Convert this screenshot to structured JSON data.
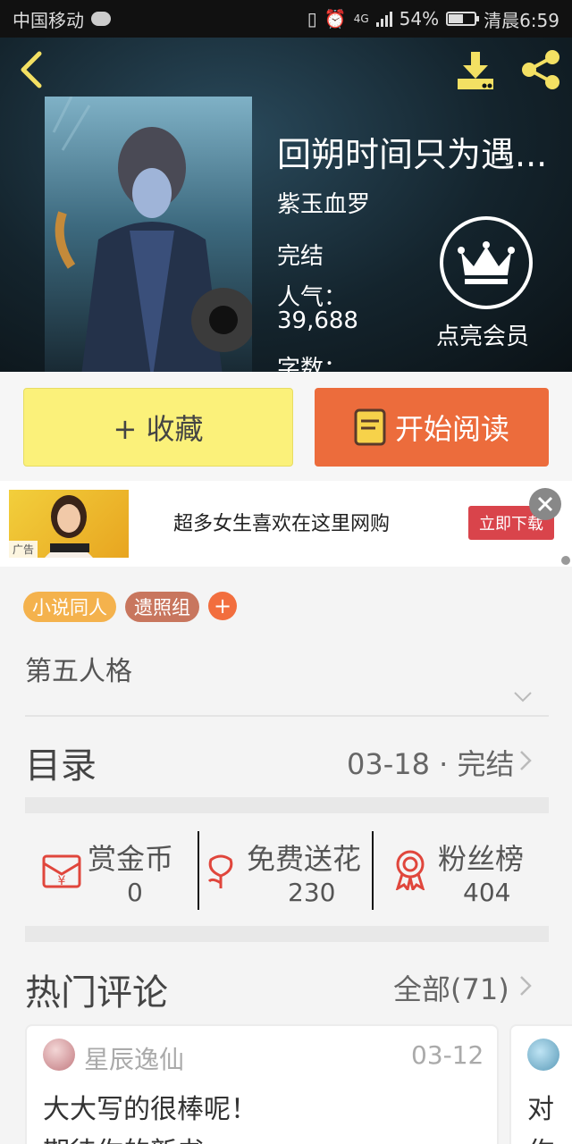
{
  "status_bar": {
    "carrier": "中国移动",
    "network": "4G",
    "battery": "54%",
    "time": "清晨6:59"
  },
  "book": {
    "title": "回朔时间只为遇...",
    "author": "紫玉血罗",
    "status": "完结",
    "popularity_label": "人气：",
    "popularity_value": "39,688",
    "word_count_label": "字数："
  },
  "vip": {
    "label": "点亮会员"
  },
  "actions": {
    "favorite_label": "+ 收藏",
    "read_label": "开始阅读"
  },
  "ad": {
    "text": "超多女生喜欢在这里网购",
    "button": "立即下载",
    "tag": "广告"
  },
  "tags": [
    "小说同人",
    "遗照组"
  ],
  "tag_add": "+",
  "synopsis": "第五人格",
  "toc": {
    "title": "目录",
    "info": "03-18 · 完结"
  },
  "stats": [
    {
      "label": "赏金币",
      "value": "0"
    },
    {
      "label": "免费送花",
      "value": "230"
    },
    {
      "label": "粉丝榜",
      "value": "404"
    }
  ],
  "comments": {
    "title": "热门评论",
    "all_label": "全部(71)",
    "items": [
      {
        "user": "星辰逸仙",
        "date": "03-12",
        "line1": "大大写的很棒呢！",
        "line2": "期待你的新书"
      },
      {
        "line1": "对",
        "line2": "作"
      }
    ]
  },
  "colors": {
    "favorite_bg": "#fbf17a",
    "read_bg": "#ec6c3c",
    "tag_1": "#f4b24d",
    "tag_2": "#c8765e",
    "tag_add": "#f26e3e",
    "icon_red": "#e0463c",
    "header_icon_yellow": "#f3e063"
  }
}
